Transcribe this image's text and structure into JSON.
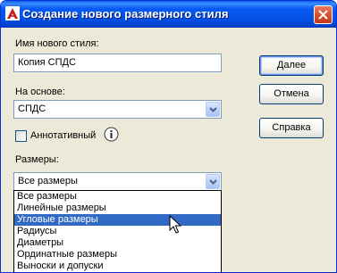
{
  "window": {
    "title": "Создание нового размерного стиля",
    "close_tooltip": "close"
  },
  "form": {
    "new_style_label": "Имя нового стиля:",
    "new_style_value": "Копия СПДС",
    "based_on_label": "На основе:",
    "based_on_value": "СПДС",
    "annotative_label": "Аннотативный",
    "annotative_checked": false,
    "dimensions_label": "Размеры:",
    "dimensions_value": "Все размеры"
  },
  "buttons": {
    "continue": "Далее",
    "cancel": "Отмена",
    "help": "Справка"
  },
  "dimensions_options": [
    "Все размеры",
    "Линейные размеры",
    "Угловые размеры",
    "Радиусы",
    "Диаметры",
    "Ординатные размеры",
    "Выноски и допуски"
  ],
  "dimensions_highlighted_index": 2,
  "icons": {
    "app": "autocad-a-icon",
    "close": "close-x-icon",
    "info": "info-i-icon",
    "dropdown": "chevron-down-icon",
    "cursor": "mouse-pointer-icon"
  },
  "colors": {
    "title_bar": "#0450e5",
    "dialog_bg": "#ece9d8",
    "selection": "#316ac5",
    "close_button": "#d9512c"
  }
}
